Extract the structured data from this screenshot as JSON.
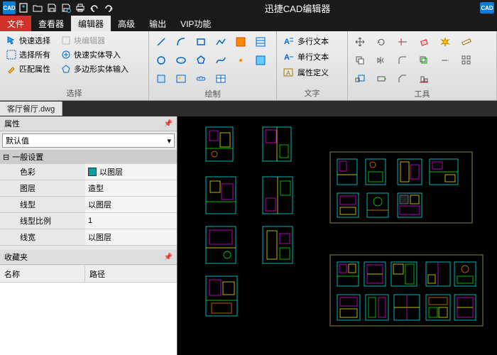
{
  "app": {
    "title": "迅捷CAD编辑器",
    "badge": "CAD"
  },
  "qat": [
    "cad",
    "new",
    "open",
    "save",
    "saveas",
    "print",
    "undo",
    "redo"
  ],
  "menu": {
    "file": "文件",
    "tabs": [
      "查看器",
      "编辑器",
      "高级",
      "输出",
      "VIP功能"
    ],
    "active": 1
  },
  "ribbon": {
    "select": {
      "label": "选择",
      "items": [
        {
          "label": "快速选择",
          "enabled": true
        },
        {
          "label": "选择所有",
          "enabled": true
        },
        {
          "label": "匹配属性",
          "enabled": true
        },
        {
          "label": "块编辑器",
          "enabled": false
        },
        {
          "label": "快速实体导入",
          "enabled": true
        },
        {
          "label": "多边形实体输入",
          "enabled": true
        }
      ]
    },
    "draw": {
      "label": "绘制"
    },
    "text": {
      "label": "文字",
      "items": [
        "多行文本",
        "单行文本",
        "属性定义"
      ]
    },
    "tools": {
      "label": "工具"
    }
  },
  "document": {
    "tab": "客厅餐厅.dwg"
  },
  "props": {
    "title": "属性",
    "combo": "默认值",
    "section": "一般设置",
    "rows": [
      {
        "k": "色彩",
        "v": "以图层",
        "swatch": true
      },
      {
        "k": "图层",
        "v": "造型"
      },
      {
        "k": "线型",
        "v": "以图层"
      },
      {
        "k": "线型比例",
        "v": "1"
      },
      {
        "k": "线宽",
        "v": "以图层"
      }
    ]
  },
  "fav": {
    "title": "收藏夹",
    "cols": [
      "名称",
      "路径"
    ]
  }
}
